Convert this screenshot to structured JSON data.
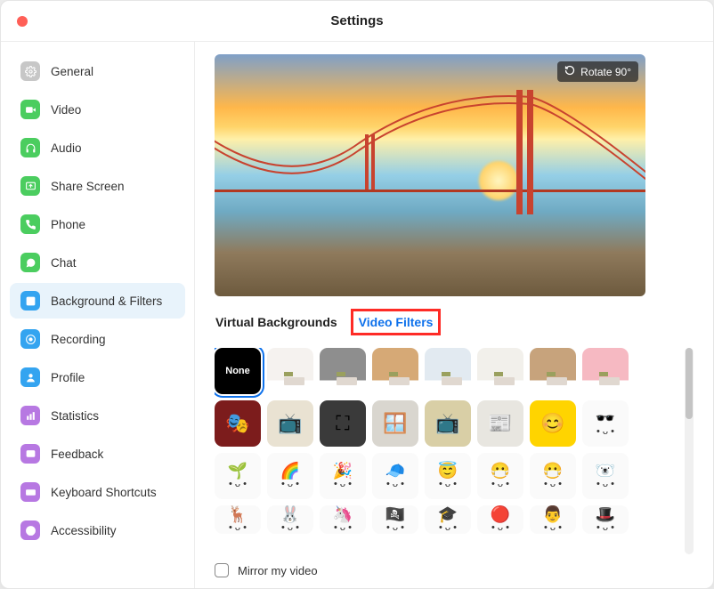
{
  "window": {
    "title": "Settings"
  },
  "sidebar": {
    "items": [
      {
        "key": "general",
        "label": "General",
        "icon": "gear",
        "color": "#c7c7c7"
      },
      {
        "key": "video",
        "label": "Video",
        "icon": "camera",
        "color": "#4bcd5f"
      },
      {
        "key": "audio",
        "label": "Audio",
        "icon": "headphones",
        "color": "#4bcd5f"
      },
      {
        "key": "share-screen",
        "label": "Share Screen",
        "icon": "share",
        "color": "#4bcd5f"
      },
      {
        "key": "phone",
        "label": "Phone",
        "icon": "phone",
        "color": "#4bcd5f"
      },
      {
        "key": "chat",
        "label": "Chat",
        "icon": "chat",
        "color": "#4bcd5f"
      },
      {
        "key": "background-filters",
        "label": "Background & Filters",
        "icon": "person-box",
        "color": "#34a4f0",
        "active": true
      },
      {
        "key": "recording",
        "label": "Recording",
        "icon": "record",
        "color": "#34a4f0"
      },
      {
        "key": "profile",
        "label": "Profile",
        "icon": "profile",
        "color": "#34a4f0"
      },
      {
        "key": "statistics",
        "label": "Statistics",
        "icon": "stats",
        "color": "#b778e2"
      },
      {
        "key": "feedback",
        "label": "Feedback",
        "icon": "feedback",
        "color": "#b778e2"
      },
      {
        "key": "keyboard-shortcuts",
        "label": "Keyboard Shortcuts",
        "icon": "keyboard",
        "color": "#b778e2"
      },
      {
        "key": "accessibility",
        "label": "Accessibility",
        "icon": "accessibility",
        "color": "#b778e2"
      }
    ]
  },
  "preview": {
    "rotate_label": "Rotate 90°"
  },
  "tabs": {
    "virtual_backgrounds": "Virtual Backgrounds",
    "video_filters": "Video Filters",
    "active": "video_filters"
  },
  "filters": {
    "rows": [
      [
        {
          "key": "none",
          "label": "None",
          "selected": true
        },
        {
          "key": "room-white",
          "type": "room",
          "wall": "#f5f2ef"
        },
        {
          "key": "room-gray",
          "type": "room",
          "wall": "#8e8e8e"
        },
        {
          "key": "room-tan",
          "type": "room",
          "wall": "#d6a976"
        },
        {
          "key": "room-cool",
          "type": "room",
          "wall": "#e2eaf1"
        },
        {
          "key": "room-light",
          "type": "room",
          "wall": "#f2f0eb"
        },
        {
          "key": "room-beige",
          "type": "room",
          "wall": "#c7a37c"
        },
        {
          "key": "room-pink",
          "type": "room",
          "wall": "#f6b9c2"
        }
      ],
      [
        {
          "key": "theater",
          "type": "thumb",
          "bg": "#7c1c1c",
          "emoji": "🎭"
        },
        {
          "key": "retro-tv",
          "type": "thumb",
          "bg": "#e9e2d2",
          "emoji": "📺"
        },
        {
          "key": "focus-frame",
          "type": "thumb",
          "bg": "#3a3a3a",
          "emoji": "⛶"
        },
        {
          "key": "window",
          "type": "thumb",
          "bg": "#d9d6cf",
          "emoji": "🪟"
        },
        {
          "key": "vintage-tv",
          "type": "thumb",
          "bg": "#d9cfa6",
          "emoji": "📺"
        },
        {
          "key": "newspaper",
          "type": "thumb",
          "bg": "#e8e6e0",
          "emoji": "📰"
        },
        {
          "key": "emoji-frame",
          "type": "thumb",
          "bg": "#ffd400",
          "emoji": "😊"
        },
        {
          "key": "deal-with-it",
          "type": "emoji",
          "emoji": "🕶️"
        }
      ],
      [
        {
          "key": "sprout",
          "type": "emoji",
          "emoji": "🌱"
        },
        {
          "key": "rainbow",
          "type": "emoji",
          "emoji": "🌈"
        },
        {
          "key": "party",
          "type": "emoji",
          "emoji": "🎉"
        },
        {
          "key": "cap",
          "type": "emoji",
          "emoji": "🧢"
        },
        {
          "key": "halo",
          "type": "emoji",
          "emoji": "😇"
        },
        {
          "key": "surgical-mask",
          "type": "emoji",
          "emoji": "😷"
        },
        {
          "key": "medical-mask",
          "type": "emoji",
          "emoji": "😷"
        },
        {
          "key": "bear",
          "type": "emoji",
          "emoji": "🐻‍❄️"
        }
      ],
      [
        {
          "key": "antlers",
          "type": "emoji",
          "emoji": "🦌"
        },
        {
          "key": "bunny-ears",
          "type": "emoji",
          "emoji": "🐰"
        },
        {
          "key": "unicorn",
          "type": "emoji",
          "emoji": "🦄"
        },
        {
          "key": "pirate",
          "type": "emoji",
          "emoji": "🏴‍☠️"
        },
        {
          "key": "grad-cap",
          "type": "emoji",
          "emoji": "🎓"
        },
        {
          "key": "beret",
          "type": "emoji",
          "emoji": "🔴"
        },
        {
          "key": "mustache",
          "type": "emoji",
          "emoji": "👨"
        },
        {
          "key": "detective",
          "type": "emoji",
          "emoji": "🎩"
        }
      ]
    ]
  },
  "footer": {
    "mirror_label": "Mirror my video",
    "mirror_checked": false
  }
}
